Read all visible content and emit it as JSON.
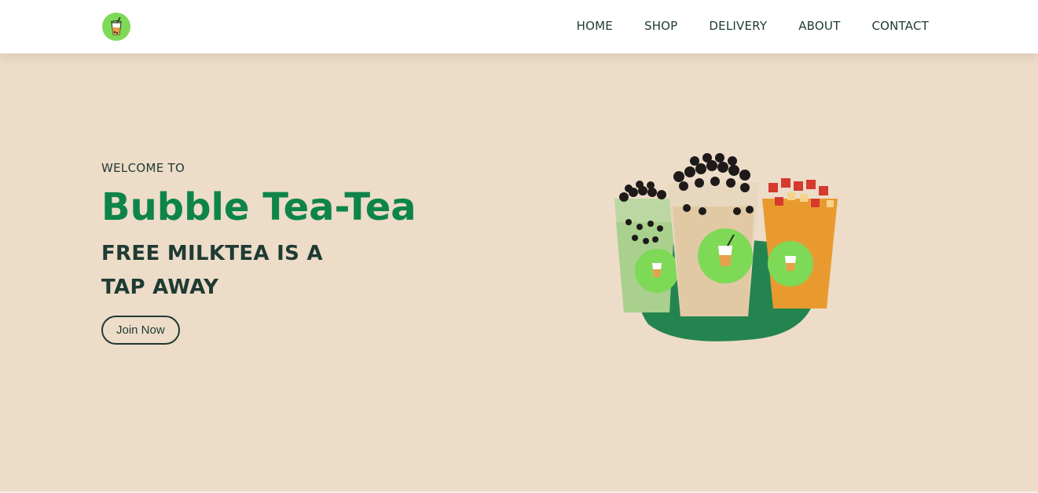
{
  "nav": {
    "logo_icon": "bubble-tea-logo-icon",
    "links": [
      {
        "label": "HOME"
      },
      {
        "label": "SHOP"
      },
      {
        "label": "DELIVERY"
      },
      {
        "label": "ABOUT"
      },
      {
        "label": "CONTACT"
      }
    ]
  },
  "hero": {
    "welcome": "WELCOME TO",
    "brand": "Bubble Tea-Tea",
    "tagline_line1": "FREE MILKTEA IS A",
    "tagline_line2": "TAP AWAY",
    "cta_label": "Join Now",
    "image_icon": "bubble-tea-cups-image"
  },
  "colors": {
    "background": "#ecdcc8",
    "brand_green": "#0e8449",
    "logo_green": "#7ed957",
    "text_dark": "#1f3a33"
  }
}
